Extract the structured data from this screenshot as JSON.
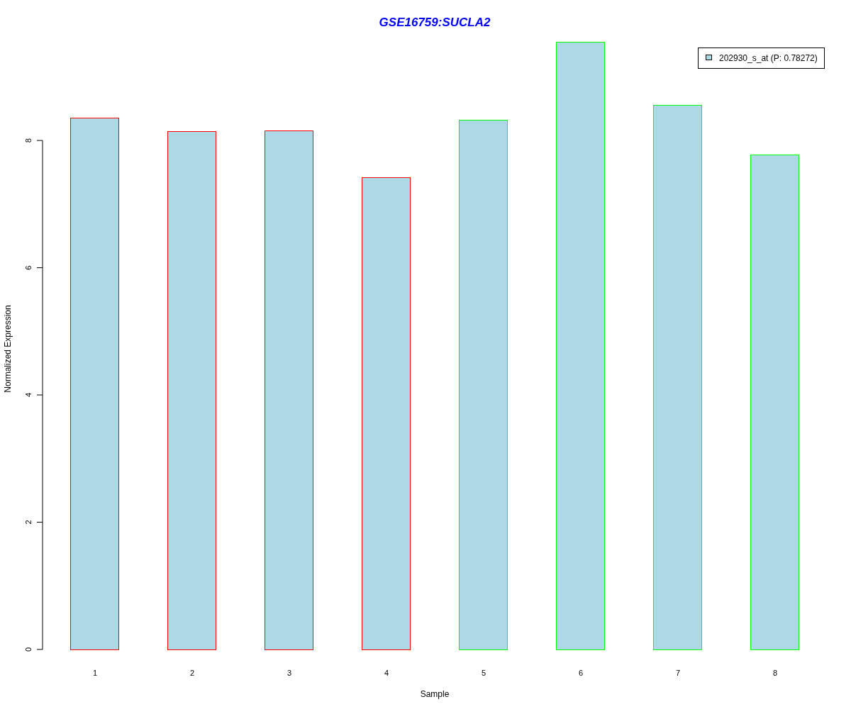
{
  "chart_data": {
    "type": "bar",
    "title": "GSE16759:SUCLA2",
    "xlabel": "Sample",
    "ylabel": "Normalized Expression",
    "categories": [
      "1",
      "2",
      "3",
      "4",
      "5",
      "6",
      "7",
      "8"
    ],
    "series": [
      {
        "name": "202930_s_at (P: 0.78272)",
        "color": "#add8e6",
        "values": [
          8.36,
          8.15,
          8.16,
          7.42,
          8.32,
          9.55,
          8.56,
          7.78
        ]
      }
    ],
    "ylim": [
      0,
      9.55
    ],
    "yticks": [
      0,
      2,
      4,
      6,
      8
    ]
  },
  "bar_outlines": [
    {
      "color": "#ff0000"
    },
    {
      "color": "#ff0000"
    },
    {
      "color": "#ff0000"
    },
    {
      "color": "#ff0000"
    },
    {
      "color": "#00ff00"
    },
    {
      "color": "#00ff00"
    },
    {
      "color": "#00ff00"
    },
    {
      "color": "#00ff00"
    }
  ]
}
